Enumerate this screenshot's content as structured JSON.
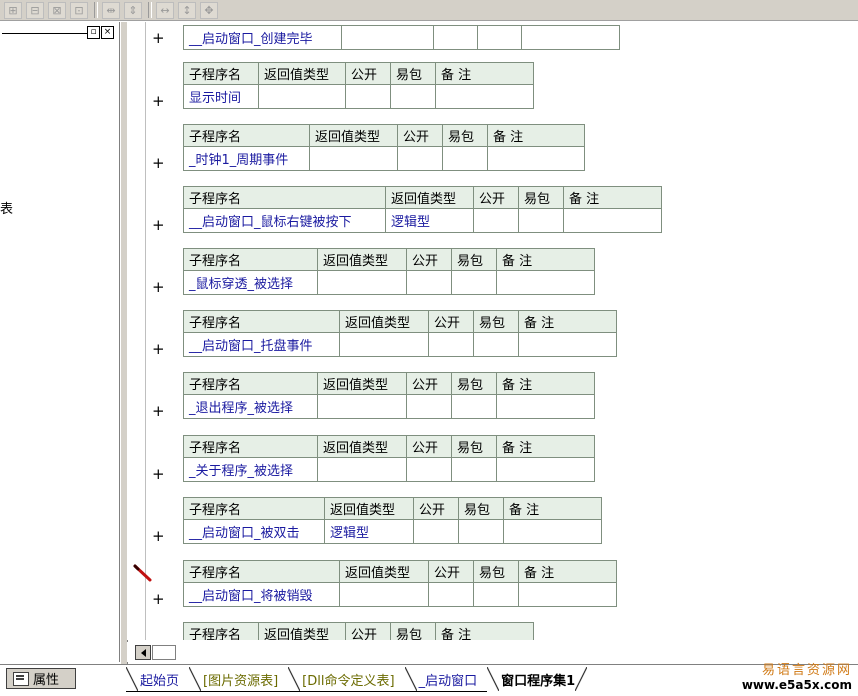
{
  "toolbar": {
    "icons": [
      "insert-table-icon",
      "split-cell-icon",
      "merge-cell-icon",
      "delete-cell-icon",
      "align-columns-icon",
      "align-rows-icon",
      "equal-width-icon",
      "equal-height-icon",
      "center-icon"
    ]
  },
  "left_panel": {
    "partial_text": "表"
  },
  "headers": {
    "name": "子程序名",
    "return_type": "返回值类型",
    "public": "公开",
    "easy_pack": "易包",
    "remark": "备 注"
  },
  "subroutines": [
    {
      "name": "__启动窗口_创建完毕",
      "return_type": ""
    },
    {
      "name": "显示时间",
      "return_type": ""
    },
    {
      "name": "_时钟1_周期事件",
      "return_type": ""
    },
    {
      "name": "__启动窗口_鼠标右键被按下",
      "return_type": "逻辑型"
    },
    {
      "name": "_鼠标穿透_被选择",
      "return_type": ""
    },
    {
      "name": "__启动窗口_托盘事件",
      "return_type": ""
    },
    {
      "name": "_退出程序_被选择",
      "return_type": ""
    },
    {
      "name": "_关于程序_被选择",
      "return_type": ""
    },
    {
      "name": "__启动窗口_被双击",
      "return_type": "逻辑型"
    },
    {
      "name": "__启动窗口_将被销毁",
      "return_type": ""
    }
  ],
  "bottom": {
    "properties_label": "属性",
    "tabs": [
      {
        "label": "起始页"
      },
      {
        "label": "[图片资源表]"
      },
      {
        "label": "[Dll命令定义表]"
      },
      {
        "label": "_启动窗口"
      },
      {
        "label": "窗口程序集1"
      }
    ],
    "watermark_line1": "易语言资源网",
    "watermark_line2": "www.e5a5x.com"
  }
}
